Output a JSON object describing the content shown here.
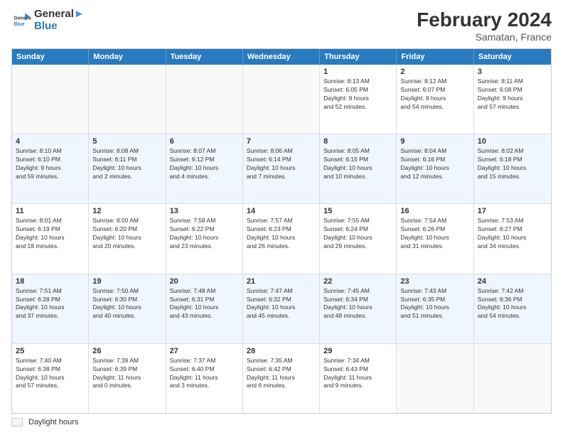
{
  "header": {
    "logo_line1": "General",
    "logo_line2": "Blue",
    "main_title": "February 2024",
    "subtitle": "Samatan, France"
  },
  "days_of_week": [
    "Sunday",
    "Monday",
    "Tuesday",
    "Wednesday",
    "Thursday",
    "Friday",
    "Saturday"
  ],
  "footer": {
    "daylight_label": "Daylight hours"
  },
  "weeks": [
    {
      "alt": false,
      "days": [
        {
          "num": "",
          "info": ""
        },
        {
          "num": "",
          "info": ""
        },
        {
          "num": "",
          "info": ""
        },
        {
          "num": "",
          "info": ""
        },
        {
          "num": "1",
          "info": "Sunrise: 8:13 AM\nSunset: 6:05 PM\nDaylight: 9 hours\nand 52 minutes."
        },
        {
          "num": "2",
          "info": "Sunrise: 8:12 AM\nSunset: 6:07 PM\nDaylight: 9 hours\nand 54 minutes."
        },
        {
          "num": "3",
          "info": "Sunrise: 8:11 AM\nSunset: 6:08 PM\nDaylight: 9 hours\nand 57 minutes."
        }
      ]
    },
    {
      "alt": true,
      "days": [
        {
          "num": "4",
          "info": "Sunrise: 8:10 AM\nSunset: 6:10 PM\nDaylight: 9 hours\nand 59 minutes."
        },
        {
          "num": "5",
          "info": "Sunrise: 8:08 AM\nSunset: 6:11 PM\nDaylight: 10 hours\nand 2 minutes."
        },
        {
          "num": "6",
          "info": "Sunrise: 8:07 AM\nSunset: 6:12 PM\nDaylight: 10 hours\nand 4 minutes."
        },
        {
          "num": "7",
          "info": "Sunrise: 8:06 AM\nSunset: 6:14 PM\nDaylight: 10 hours\nand 7 minutes."
        },
        {
          "num": "8",
          "info": "Sunrise: 8:05 AM\nSunset: 6:15 PM\nDaylight: 10 hours\nand 10 minutes."
        },
        {
          "num": "9",
          "info": "Sunrise: 8:04 AM\nSunset: 6:16 PM\nDaylight: 10 hours\nand 12 minutes."
        },
        {
          "num": "10",
          "info": "Sunrise: 8:02 AM\nSunset: 6:18 PM\nDaylight: 10 hours\nand 15 minutes."
        }
      ]
    },
    {
      "alt": false,
      "days": [
        {
          "num": "11",
          "info": "Sunrise: 8:01 AM\nSunset: 6:19 PM\nDaylight: 10 hours\nand 18 minutes."
        },
        {
          "num": "12",
          "info": "Sunrise: 8:00 AM\nSunset: 6:20 PM\nDaylight: 10 hours\nand 20 minutes."
        },
        {
          "num": "13",
          "info": "Sunrise: 7:58 AM\nSunset: 6:22 PM\nDaylight: 10 hours\nand 23 minutes."
        },
        {
          "num": "14",
          "info": "Sunrise: 7:57 AM\nSunset: 6:23 PM\nDaylight: 10 hours\nand 26 minutes."
        },
        {
          "num": "15",
          "info": "Sunrise: 7:55 AM\nSunset: 6:24 PM\nDaylight: 10 hours\nand 29 minutes."
        },
        {
          "num": "16",
          "info": "Sunrise: 7:54 AM\nSunset: 6:26 PM\nDaylight: 10 hours\nand 31 minutes."
        },
        {
          "num": "17",
          "info": "Sunrise: 7:53 AM\nSunset: 6:27 PM\nDaylight: 10 hours\nand 34 minutes."
        }
      ]
    },
    {
      "alt": true,
      "days": [
        {
          "num": "18",
          "info": "Sunrise: 7:51 AM\nSunset: 6:28 PM\nDaylight: 10 hours\nand 37 minutes."
        },
        {
          "num": "19",
          "info": "Sunrise: 7:50 AM\nSunset: 6:30 PM\nDaylight: 10 hours\nand 40 minutes."
        },
        {
          "num": "20",
          "info": "Sunrise: 7:48 AM\nSunset: 6:31 PM\nDaylight: 10 hours\nand 43 minutes."
        },
        {
          "num": "21",
          "info": "Sunrise: 7:47 AM\nSunset: 6:32 PM\nDaylight: 10 hours\nand 45 minutes."
        },
        {
          "num": "22",
          "info": "Sunrise: 7:45 AM\nSunset: 6:34 PM\nDaylight: 10 hours\nand 48 minutes."
        },
        {
          "num": "23",
          "info": "Sunrise: 7:43 AM\nSunset: 6:35 PM\nDaylight: 10 hours\nand 51 minutes."
        },
        {
          "num": "24",
          "info": "Sunrise: 7:42 AM\nSunset: 6:36 PM\nDaylight: 10 hours\nand 54 minutes."
        }
      ]
    },
    {
      "alt": false,
      "days": [
        {
          "num": "25",
          "info": "Sunrise: 7:40 AM\nSunset: 6:38 PM\nDaylight: 10 hours\nand 57 minutes."
        },
        {
          "num": "26",
          "info": "Sunrise: 7:39 AM\nSunset: 6:39 PM\nDaylight: 11 hours\nand 0 minutes."
        },
        {
          "num": "27",
          "info": "Sunrise: 7:37 AM\nSunset: 6:40 PM\nDaylight: 11 hours\nand 3 minutes."
        },
        {
          "num": "28",
          "info": "Sunrise: 7:35 AM\nSunset: 6:42 PM\nDaylight: 11 hours\nand 6 minutes."
        },
        {
          "num": "29",
          "info": "Sunrise: 7:34 AM\nSunset: 6:43 PM\nDaylight: 11 hours\nand 9 minutes."
        },
        {
          "num": "",
          "info": ""
        },
        {
          "num": "",
          "info": ""
        }
      ]
    }
  ]
}
